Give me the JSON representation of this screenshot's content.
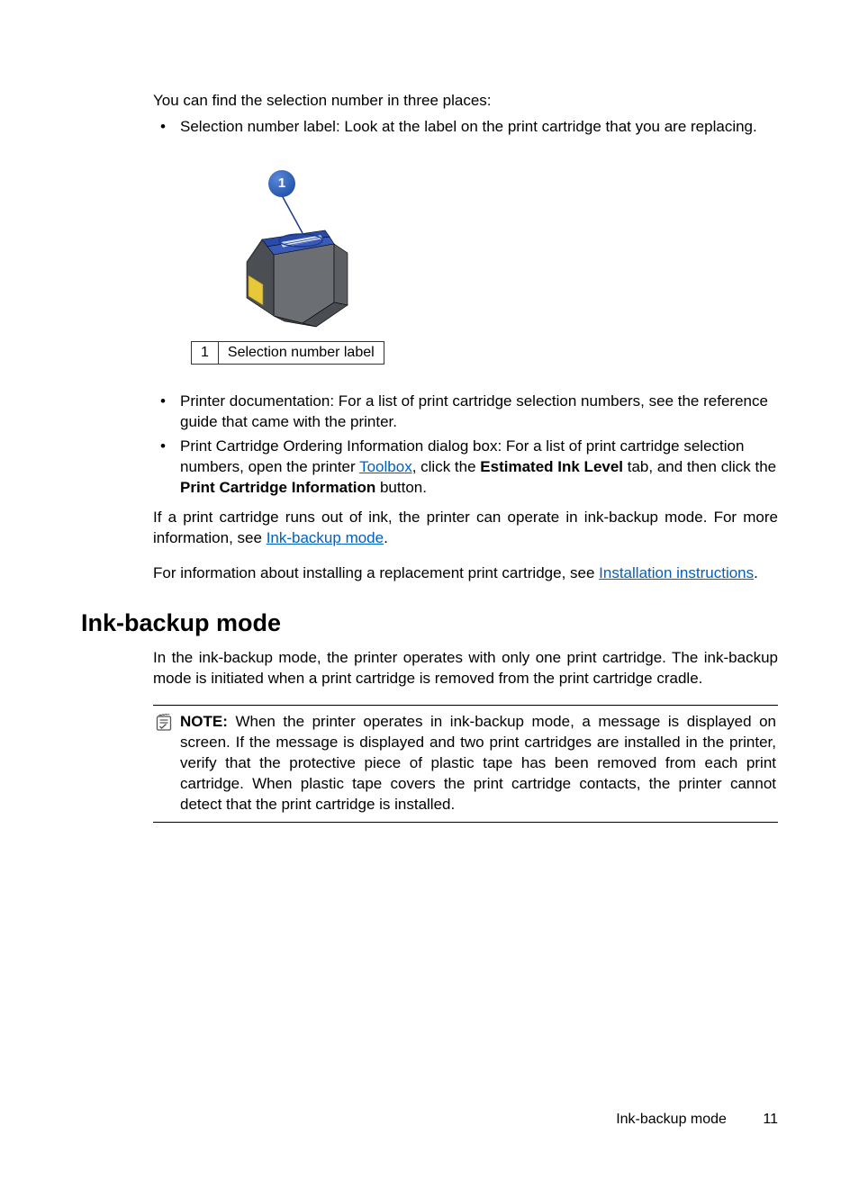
{
  "intro": "You can find the selection number in three places:",
  "bullets_top": [
    "Selection number label: Look at the label on the print cartridge that you are replacing."
  ],
  "callout": {
    "number": "1"
  },
  "legend": {
    "num": "1",
    "text": "Selection number label"
  },
  "bullets_mid": {
    "b1": "Printer documentation: For a list of print cartridge selection numbers, see the reference guide that came with the printer.",
    "b2_pre": "Print Cartridge Ordering Information dialog box: For a list of print cartridge selection numbers, open the printer ",
    "b2_link1": "Toolbox",
    "b2_mid1": ", click the ",
    "b2_bold1": "Estimated Ink Level",
    "b2_mid2": " tab, and then click the ",
    "b2_bold2": "Print Cartridge Information",
    "b2_end": " button."
  },
  "para1": {
    "pre": "If a print cartridge runs out of ink, the printer can operate in ink-backup mode. For more information, see ",
    "link": "Ink-backup mode",
    "post": "."
  },
  "para2": {
    "pre": "For information about installing a replacement print cartridge, see ",
    "link": "Installation instructions",
    "post": "."
  },
  "heading": "Ink-backup mode",
  "para3": "In the ink-backup mode, the printer operates with only one print cartridge. The ink-backup mode is initiated when a print cartridge is removed from the print cartridge cradle.",
  "note": {
    "label": "NOTE:",
    "body": " When the printer operates in ink-backup mode, a message is displayed on screen. If the message is displayed and two print cartridges are installed in the printer, verify that the protective piece of plastic tape has been removed from each print cartridge. When plastic tape covers the print cartridge contacts, the printer cannot detect that the print cartridge is installed."
  },
  "footer": {
    "section": "Ink-backup mode",
    "page": "11"
  }
}
